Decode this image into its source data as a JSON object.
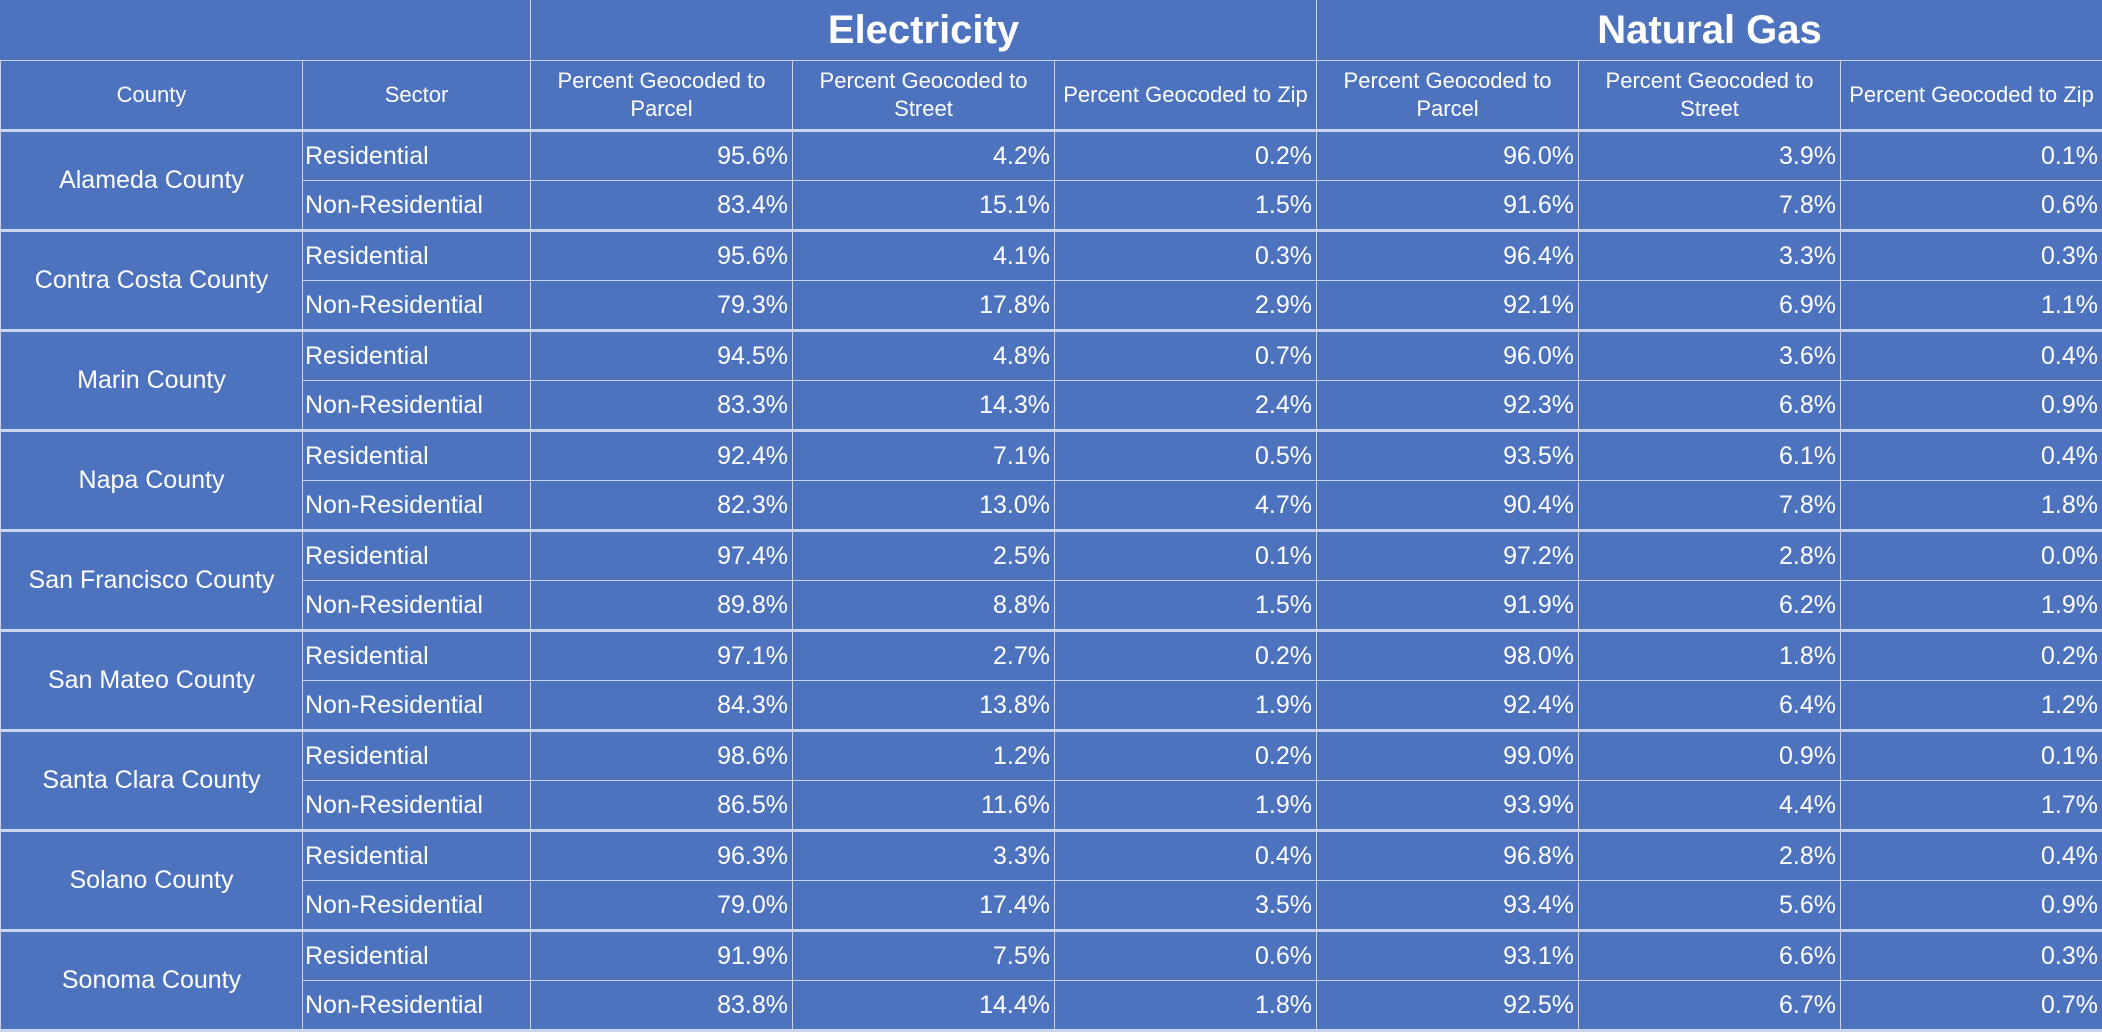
{
  "header": {
    "groups": [
      "Electricity",
      "Natural Gas"
    ],
    "columns": {
      "county": "County",
      "sector": "Sector",
      "elec_parcel": "Percent Geocoded to Parcel",
      "elec_street": "Percent Geocoded to Street",
      "elec_zip": "Percent Geocoded to Zip",
      "gas_parcel": "Percent Geocoded to Parcel",
      "gas_street": "Percent Geocoded to Street",
      "gas_zip": "Percent Geocoded to Zip"
    }
  },
  "rows": [
    {
      "county": "Alameda County",
      "sectors": [
        {
          "sector": "Residential",
          "elec": [
            "95.6%",
            "4.2%",
            "0.2%"
          ],
          "gas": [
            "96.0%",
            "3.9%",
            "0.1%"
          ]
        },
        {
          "sector": "Non-Residential",
          "elec": [
            "83.4%",
            "15.1%",
            "1.5%"
          ],
          "gas": [
            "91.6%",
            "7.8%",
            "0.6%"
          ]
        }
      ]
    },
    {
      "county": "Contra Costa County",
      "sectors": [
        {
          "sector": "Residential",
          "elec": [
            "95.6%",
            "4.1%",
            "0.3%"
          ],
          "gas": [
            "96.4%",
            "3.3%",
            "0.3%"
          ]
        },
        {
          "sector": "Non-Residential",
          "elec": [
            "79.3%",
            "17.8%",
            "2.9%"
          ],
          "gas": [
            "92.1%",
            "6.9%",
            "1.1%"
          ]
        }
      ]
    },
    {
      "county": "Marin County",
      "sectors": [
        {
          "sector": "Residential",
          "elec": [
            "94.5%",
            "4.8%",
            "0.7%"
          ],
          "gas": [
            "96.0%",
            "3.6%",
            "0.4%"
          ]
        },
        {
          "sector": "Non-Residential",
          "elec": [
            "83.3%",
            "14.3%",
            "2.4%"
          ],
          "gas": [
            "92.3%",
            "6.8%",
            "0.9%"
          ]
        }
      ]
    },
    {
      "county": "Napa County",
      "sectors": [
        {
          "sector": "Residential",
          "elec": [
            "92.4%",
            "7.1%",
            "0.5%"
          ],
          "gas": [
            "93.5%",
            "6.1%",
            "0.4%"
          ]
        },
        {
          "sector": "Non-Residential",
          "elec": [
            "82.3%",
            "13.0%",
            "4.7%"
          ],
          "gas": [
            "90.4%",
            "7.8%",
            "1.8%"
          ]
        }
      ]
    },
    {
      "county": "San Francisco County",
      "sectors": [
        {
          "sector": "Residential",
          "elec": [
            "97.4%",
            "2.5%",
            "0.1%"
          ],
          "gas": [
            "97.2%",
            "2.8%",
            "0.0%"
          ]
        },
        {
          "sector": "Non-Residential",
          "elec": [
            "89.8%",
            "8.8%",
            "1.5%"
          ],
          "gas": [
            "91.9%",
            "6.2%",
            "1.9%"
          ]
        }
      ]
    },
    {
      "county": "San Mateo County",
      "sectors": [
        {
          "sector": "Residential",
          "elec": [
            "97.1%",
            "2.7%",
            "0.2%"
          ],
          "gas": [
            "98.0%",
            "1.8%",
            "0.2%"
          ]
        },
        {
          "sector": "Non-Residential",
          "elec": [
            "84.3%",
            "13.8%",
            "1.9%"
          ],
          "gas": [
            "92.4%",
            "6.4%",
            "1.2%"
          ]
        }
      ]
    },
    {
      "county": "Santa Clara County",
      "sectors": [
        {
          "sector": "Residential",
          "elec": [
            "98.6%",
            "1.2%",
            "0.2%"
          ],
          "gas": [
            "99.0%",
            "0.9%",
            "0.1%"
          ]
        },
        {
          "sector": "Non-Residential",
          "elec": [
            "86.5%",
            "11.6%",
            "1.9%"
          ],
          "gas": [
            "93.9%",
            "4.4%",
            "1.7%"
          ]
        }
      ]
    },
    {
      "county": "Solano County",
      "sectors": [
        {
          "sector": "Residential",
          "elec": [
            "96.3%",
            "3.3%",
            "0.4%"
          ],
          "gas": [
            "96.8%",
            "2.8%",
            "0.4%"
          ]
        },
        {
          "sector": "Non-Residential",
          "elec": [
            "79.0%",
            "17.4%",
            "3.5%"
          ],
          "gas": [
            "93.4%",
            "5.6%",
            "0.9%"
          ]
        }
      ]
    },
    {
      "county": "Sonoma County",
      "sectors": [
        {
          "sector": "Residential",
          "elec": [
            "91.9%",
            "7.5%",
            "0.6%"
          ],
          "gas": [
            "93.1%",
            "6.6%",
            "0.3%"
          ]
        },
        {
          "sector": "Non-Residential",
          "elec": [
            "83.8%",
            "14.4%",
            "1.8%"
          ],
          "gas": [
            "92.5%",
            "6.7%",
            "0.7%"
          ]
        }
      ]
    }
  ]
}
